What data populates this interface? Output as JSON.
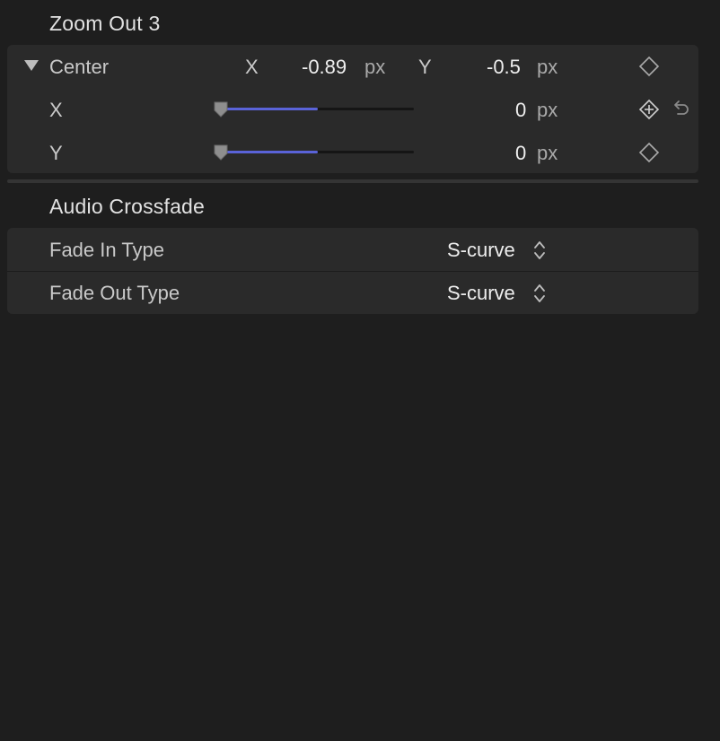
{
  "zoom": {
    "title": "Zoom Out 3",
    "center": {
      "label": "Center",
      "x_axis_label": "X",
      "x_value": "-0.89",
      "x_unit": "px",
      "y_axis_label": "Y",
      "y_value": "-0.5",
      "y_unit": "px"
    },
    "x_row": {
      "label": "X",
      "value": "0",
      "unit": "px",
      "slider_fraction": 0.5
    },
    "y_row": {
      "label": "Y",
      "value": "0",
      "unit": "px",
      "slider_fraction": 0.5
    }
  },
  "audio": {
    "title": "Audio Crossfade",
    "fade_in": {
      "label": "Fade In Type",
      "value": "S-curve"
    },
    "fade_out": {
      "label": "Fade Out Type",
      "value": "S-curve"
    }
  },
  "colors": {
    "slider_fill": "#5a63d8",
    "background": "#1e1e1e",
    "group_bg": "#2a2a2a"
  },
  "icons": {
    "disclosure": "disclosure-triangle-icon",
    "keyframe": "keyframe-diamond-icon",
    "add_keyframe": "add-keyframe-icon",
    "reset": "reset-arrow-icon",
    "stepper": "popup-stepper-icon"
  }
}
